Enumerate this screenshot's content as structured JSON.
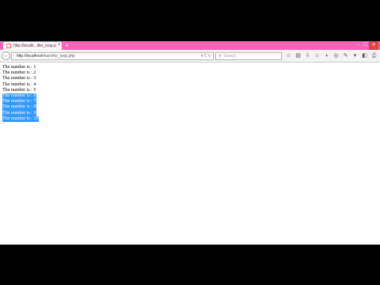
{
  "browser": {
    "tab_title": "http://localh...iller_loop.php",
    "tab_close": "×",
    "new_tab": "+",
    "window_controls": [
      "–",
      "☐",
      "✕"
    ],
    "back": "←",
    "url_host": "http://localhost",
    "url_path": "/learn/for_loop.php",
    "url_controls": "▾ C ↻",
    "search_placeholder": "Search",
    "search_icon": "magnifier-icon",
    "accent_color": "#f565b8"
  },
  "page": {
    "lines": [
      {
        "text": "The number is : 1",
        "selected": false
      },
      {
        "text": "The number is : 2",
        "selected": false
      },
      {
        "text": "The number is : 3",
        "selected": false
      },
      {
        "text": "The number is : 4",
        "selected": false
      },
      {
        "text": "The number is : 5",
        "selected": false
      },
      {
        "text": "The number is : 6",
        "selected": true
      },
      {
        "text": "The number is : 7",
        "selected": true
      },
      {
        "text": "The number is : 8",
        "selected": true
      },
      {
        "text": "The number is : 9",
        "selected": true
      },
      {
        "text": "The number is : 10",
        "selected": true
      }
    ],
    "selection_color": "#3399ff"
  }
}
